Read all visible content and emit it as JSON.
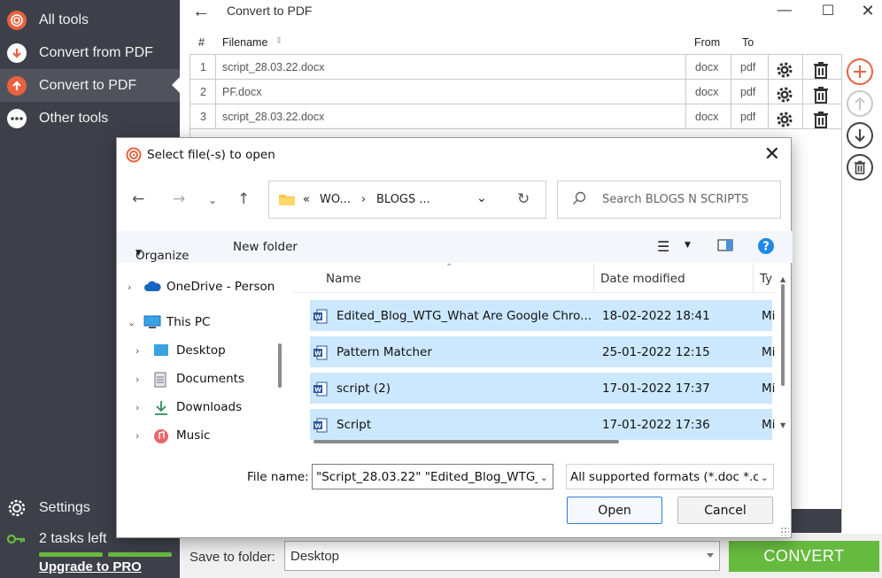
{
  "sidebar": {
    "items": [
      {
        "label": "All tools",
        "icon": "spiral-icon"
      },
      {
        "label": "Convert from PDF",
        "icon": "arrow-down-icon"
      },
      {
        "label": "Convert to PDF",
        "icon": "arrow-up-icon"
      },
      {
        "label": "Other tools",
        "icon": "ellipsis-icon"
      }
    ],
    "settings_label": "Settings",
    "tasks_label": "2 tasks left",
    "upgrade_label": "Upgrade to PRO"
  },
  "main": {
    "title": "Convert to PDF",
    "columns": {
      "num": "#",
      "filename": "Filename",
      "from": "From",
      "to": "To"
    },
    "files": [
      {
        "num": "1",
        "name": "script_28.03.22.docx",
        "from": "docx",
        "to": "pdf"
      },
      {
        "num": "2",
        "name": "PF.docx",
        "from": "docx",
        "to": "pdf"
      },
      {
        "num": "3",
        "name": "script_28.03.22.docx",
        "from": "docx",
        "to": "pdf"
      }
    ],
    "save_label": "Save to folder:",
    "save_value": "Desktop",
    "convert_label": "CONVERT"
  },
  "dialog": {
    "title": "Select file(-s) to open",
    "address": {
      "prefix": "«",
      "crumb1": "WO...",
      "sep": "›",
      "crumb2": "BLOGS ..."
    },
    "search_placeholder": "Search BLOGS N SCRIPTS",
    "organize_label": "Organize",
    "new_folder_label": "New folder",
    "nav_items": [
      {
        "label": "OneDrive - Person"
      },
      {
        "label": "This PC"
      },
      {
        "label": "Desktop"
      },
      {
        "label": "Documents"
      },
      {
        "label": "Downloads"
      },
      {
        "label": "Music"
      }
    ],
    "columns": {
      "name": "Name",
      "date": "Date modified",
      "type": "Ty"
    },
    "files": [
      {
        "name": "Edited_Blog_WTG_What Are Google Chro...",
        "date": "18-02-2022 18:41",
        "type": "Mi"
      },
      {
        "name": "Pattern Matcher",
        "date": "25-01-2022 12:15",
        "type": "Mi"
      },
      {
        "name": "script (2)",
        "date": "17-01-2022 17:37",
        "type": "Mi"
      },
      {
        "name": "Script",
        "date": "17-01-2022 17:36",
        "type": "Mi"
      }
    ],
    "filename_label": "File name:",
    "filename_value": "\"Script_28.03.22\" \"Edited_Blog_WTG_'",
    "filetype_value": "All supported formats (*.doc *.c",
    "open_label": "Open",
    "cancel_label": "Cancel"
  },
  "colors": {
    "accent_green": "#66bb3f",
    "sidebar": "#3d4049",
    "accent_red": "#e9613e",
    "selection": "#cce8ff"
  }
}
